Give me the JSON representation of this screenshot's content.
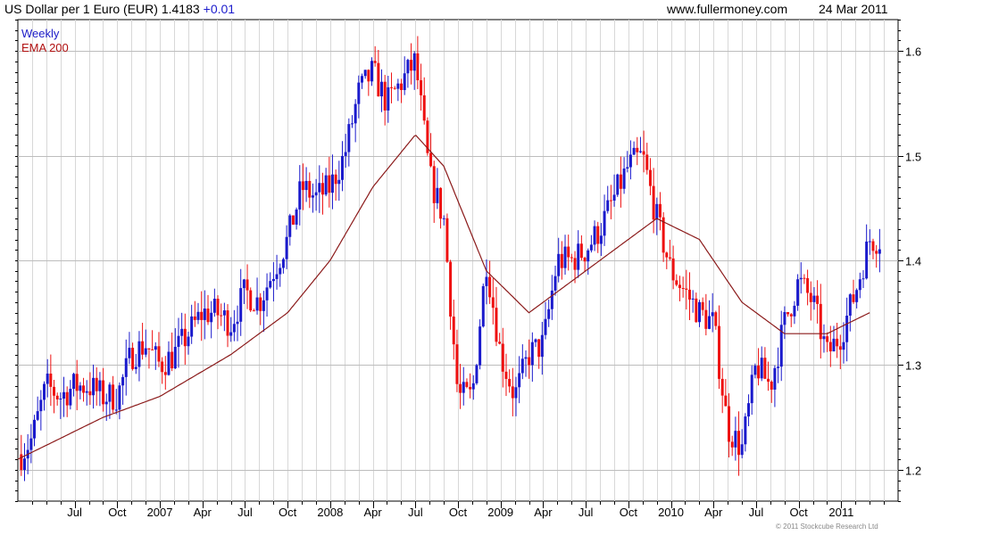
{
  "header": {
    "title": "US Dollar per 1 Euro (EUR) 1.4183",
    "change": "+0.01",
    "site": "www.fullermoney.com",
    "date": "24 Mar 2011"
  },
  "legend": {
    "weekly": "Weekly",
    "ema": "EMA 200"
  },
  "copyright": "© 2011 Stockcube Research Ltd",
  "colors": {
    "up": "#1a1acc",
    "down": "#ee1111",
    "ema": "#8b1a1a",
    "grid": "#d8d8d8"
  },
  "chart_data": {
    "type": "line",
    "title": "US Dollar per 1 Euro (EUR) 1.4183",
    "ylim": [
      1.17,
      1.63
    ],
    "y_ticks": [
      1.2,
      1.3,
      1.4,
      1.5,
      1.6
    ],
    "y_tick_labels": [
      "1.2",
      "1.3",
      "1.4",
      "1.5",
      "1.6"
    ],
    "x_ticks": [
      "Jul",
      "Oct",
      "2007",
      "Apr",
      "Jul",
      "Oct",
      "2008",
      "Apr",
      "Jul",
      "Oct",
      "2009",
      "Apr",
      "Jul",
      "Oct",
      "2010",
      "Apr",
      "Jul",
      "Oct",
      "2011"
    ],
    "grid": true,
    "series": [
      {
        "name": "Weekly",
        "style": "candlestick",
        "x": [
          "2006-03",
          "2006-04",
          "2006-05",
          "2006-06",
          "2006-07",
          "2006-08",
          "2006-09",
          "2006-10",
          "2006-11",
          "2006-12",
          "2007-01",
          "2007-02",
          "2007-03",
          "2007-04",
          "2007-05",
          "2007-06",
          "2007-07",
          "2007-08",
          "2007-09",
          "2007-10",
          "2007-11",
          "2007-12",
          "2008-01",
          "2008-02",
          "2008-03",
          "2008-04",
          "2008-05",
          "2008-06",
          "2008-07",
          "2008-08",
          "2008-09",
          "2008-10",
          "2008-11",
          "2008-12",
          "2009-01",
          "2009-02",
          "2009-03",
          "2009-04",
          "2009-05",
          "2009-06",
          "2009-07",
          "2009-08",
          "2009-09",
          "2009-10",
          "2009-11",
          "2009-12",
          "2010-01",
          "2010-02",
          "2010-03",
          "2010-04",
          "2010-05",
          "2010-06",
          "2010-07",
          "2010-08",
          "2010-09",
          "2010-10",
          "2010-11",
          "2010-12",
          "2011-01",
          "2011-02",
          "2011-03"
        ],
        "values": [
          1.21,
          1.23,
          1.28,
          1.27,
          1.28,
          1.28,
          1.27,
          1.27,
          1.31,
          1.32,
          1.3,
          1.31,
          1.33,
          1.35,
          1.35,
          1.34,
          1.37,
          1.36,
          1.39,
          1.42,
          1.47,
          1.46,
          1.47,
          1.5,
          1.56,
          1.58,
          1.55,
          1.57,
          1.59,
          1.48,
          1.44,
          1.27,
          1.27,
          1.4,
          1.31,
          1.27,
          1.31,
          1.32,
          1.4,
          1.4,
          1.41,
          1.43,
          1.46,
          1.49,
          1.5,
          1.44,
          1.39,
          1.37,
          1.35,
          1.34,
          1.24,
          1.22,
          1.3,
          1.28,
          1.34,
          1.38,
          1.36,
          1.31,
          1.33,
          1.37,
          1.42
        ]
      },
      {
        "name": "EMA 200",
        "style": "line",
        "x": [
          "2006-03",
          "2006-09",
          "2007-01",
          "2007-06",
          "2007-10",
          "2008-01",
          "2008-04",
          "2008-07",
          "2008-09",
          "2008-12",
          "2009-03",
          "2009-06",
          "2009-09",
          "2009-12",
          "2010-03",
          "2010-06",
          "2010-09",
          "2010-12",
          "2011-03"
        ],
        "values": [
          1.21,
          1.25,
          1.27,
          1.31,
          1.35,
          1.4,
          1.47,
          1.52,
          1.49,
          1.39,
          1.35,
          1.38,
          1.41,
          1.44,
          1.42,
          1.36,
          1.33,
          1.33,
          1.35
        ]
      }
    ]
  }
}
